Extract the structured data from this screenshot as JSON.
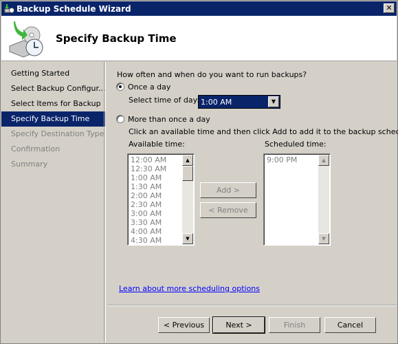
{
  "window": {
    "title": "Backup Schedule Wizard",
    "close_label": "✕"
  },
  "header": {
    "title": "Specify Backup Time"
  },
  "sidebar": {
    "items": [
      {
        "label": "Getting Started",
        "state": "done"
      },
      {
        "label": "Select Backup Configur...",
        "state": "done"
      },
      {
        "label": "Select Items for Backup",
        "state": "done"
      },
      {
        "label": "Specify Backup Time",
        "state": "active"
      },
      {
        "label": "Specify Destination Type",
        "state": "disabled"
      },
      {
        "label": "Confirmation",
        "state": "disabled"
      },
      {
        "label": "Summary",
        "state": "disabled"
      }
    ]
  },
  "main": {
    "question": "How often and when do you want to run backups?",
    "once_label": "Once a day",
    "select_time_label": "Select time of day:",
    "selected_time": "1:00 AM",
    "more_label": "More than once a day",
    "instructions": "Click an available time and then click Add to add it to the backup schedule.",
    "available_label": "Available time:",
    "scheduled_label": "Scheduled time:",
    "available_times": [
      "12:00 AM",
      "12:30 AM",
      "1:00 AM",
      "1:30 AM",
      "2:00 AM",
      "2:30 AM",
      "3:00 AM",
      "3:30 AM",
      "4:00 AM",
      "4:30 AM"
    ],
    "scheduled_times": [
      "9:00 PM"
    ],
    "add_label": "Add >",
    "remove_label": "< Remove",
    "link": "Learn about more scheduling options"
  },
  "footer": {
    "previous": "< Previous",
    "next": "Next >",
    "finish": "Finish",
    "cancel": "Cancel"
  },
  "colors": {
    "titlebar": "#0a246a",
    "face": "#d4d0c8",
    "selection": "#0a246a",
    "link": "#0000ff"
  }
}
